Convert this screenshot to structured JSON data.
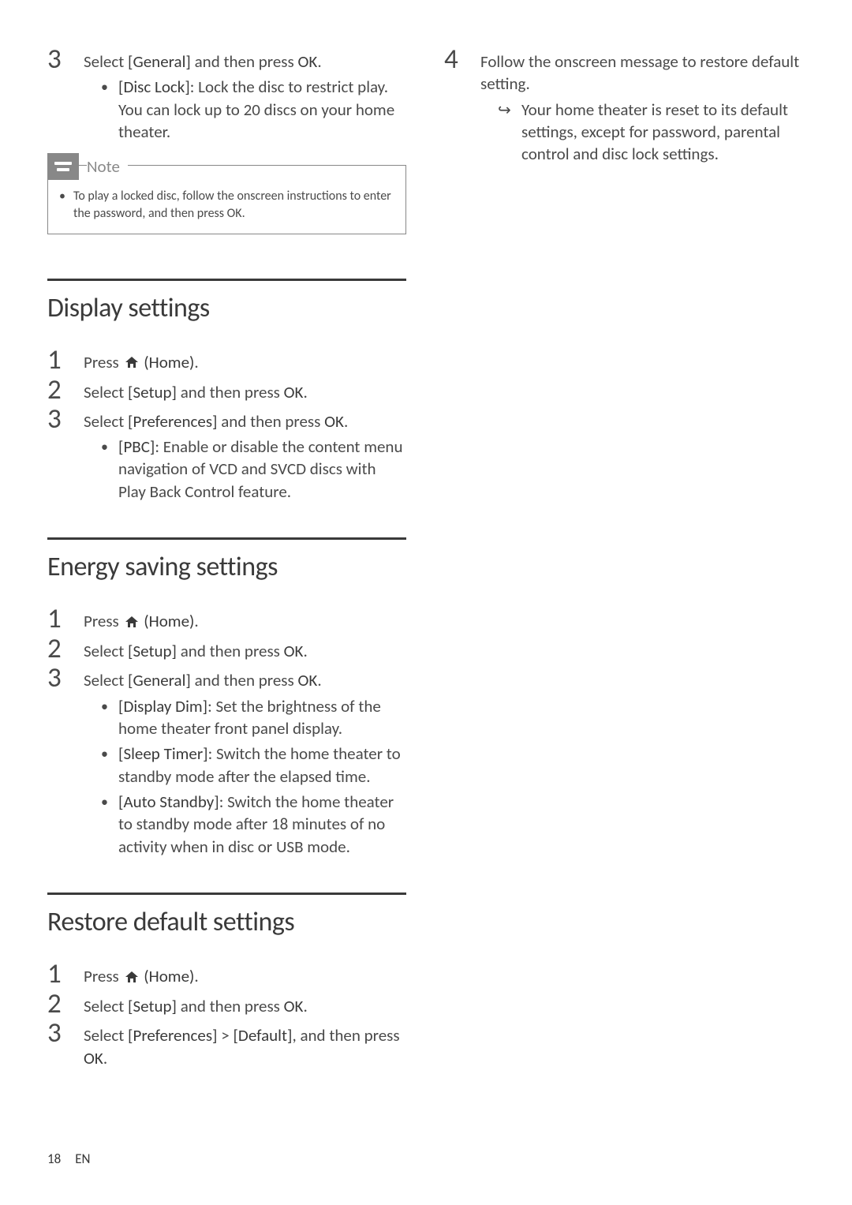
{
  "left": {
    "step3": {
      "num": "3",
      "line": {
        "pre": "Select ",
        "b1": "[General]",
        "mid": " and then press ",
        "b2": "OK",
        "post": "."
      },
      "sub": {
        "b": "[Disc Lock]",
        "text": ": Lock the disc to restrict play. You can lock up to 20 discs on your home theater."
      }
    },
    "note": {
      "label": "Note",
      "text": {
        "pre": "To play a locked disc, follow the onscreen instructions to enter the password, and then press ",
        "b": "OK",
        "post": "."
      }
    },
    "display": {
      "title": "Display settings",
      "s1": {
        "num": "1",
        "pre": "Press ",
        "home": "(Home)",
        "post": "."
      },
      "s2": {
        "num": "2",
        "pre": "Select ",
        "b1": "[Setup]",
        "mid": " and then press ",
        "b2": "OK",
        "post": "."
      },
      "s3": {
        "num": "3",
        "pre": "Select ",
        "b1": "[Preferences]",
        "mid": " and then press ",
        "b2": "OK",
        "post": ".",
        "sub": {
          "b": "[PBC]",
          "text": ": Enable or disable the content menu navigation of VCD and SVCD discs with Play Back Control feature."
        }
      }
    },
    "energy": {
      "title": "Energy saving settings",
      "s1": {
        "num": "1",
        "pre": "Press ",
        "home": "(Home)",
        "post": "."
      },
      "s2": {
        "num": "2",
        "pre": "Select ",
        "b1": "[Setup]",
        "mid": " and then press ",
        "b2": "OK",
        "post": "."
      },
      "s3": {
        "num": "3",
        "pre": "Select ",
        "b1": "[General]",
        "mid": " and then press ",
        "b2": "OK",
        "post": ".",
        "sub1": {
          "b": "[Display Dim]",
          "text": ": Set the brightness of the home theater front panel display."
        },
        "sub2": {
          "b": "[Sleep Timer]",
          "text": ": Switch the home theater to standby mode after the elapsed time."
        },
        "sub3": {
          "b": "[Auto Standby]",
          "text": ": Switch the home theater to standby mode after 18 minutes of no activity when in disc or USB mode."
        }
      }
    },
    "restore": {
      "title": "Restore default settings",
      "s1": {
        "num": "1",
        "pre": "Press ",
        "home": "(Home)",
        "post": "."
      },
      "s2": {
        "num": "2",
        "pre": "Select ",
        "b1": "[Setup]",
        "mid": " and then press ",
        "b2": "OK",
        "post": "."
      },
      "s3": {
        "num": "3",
        "pre": "Select ",
        "b1": "[Preferences]",
        "gt": " > ",
        "b2": "[Default]",
        "mid": ", and then press ",
        "b3": "OK",
        "post": "."
      }
    }
  },
  "right": {
    "s4": {
      "num": "4",
      "text": "Follow the onscreen message to restore default setting.",
      "arrow": "Your home theater is reset to its default settings, except for password, parental control and disc lock settings."
    }
  },
  "footer": {
    "page": "18",
    "lang": "EN"
  }
}
